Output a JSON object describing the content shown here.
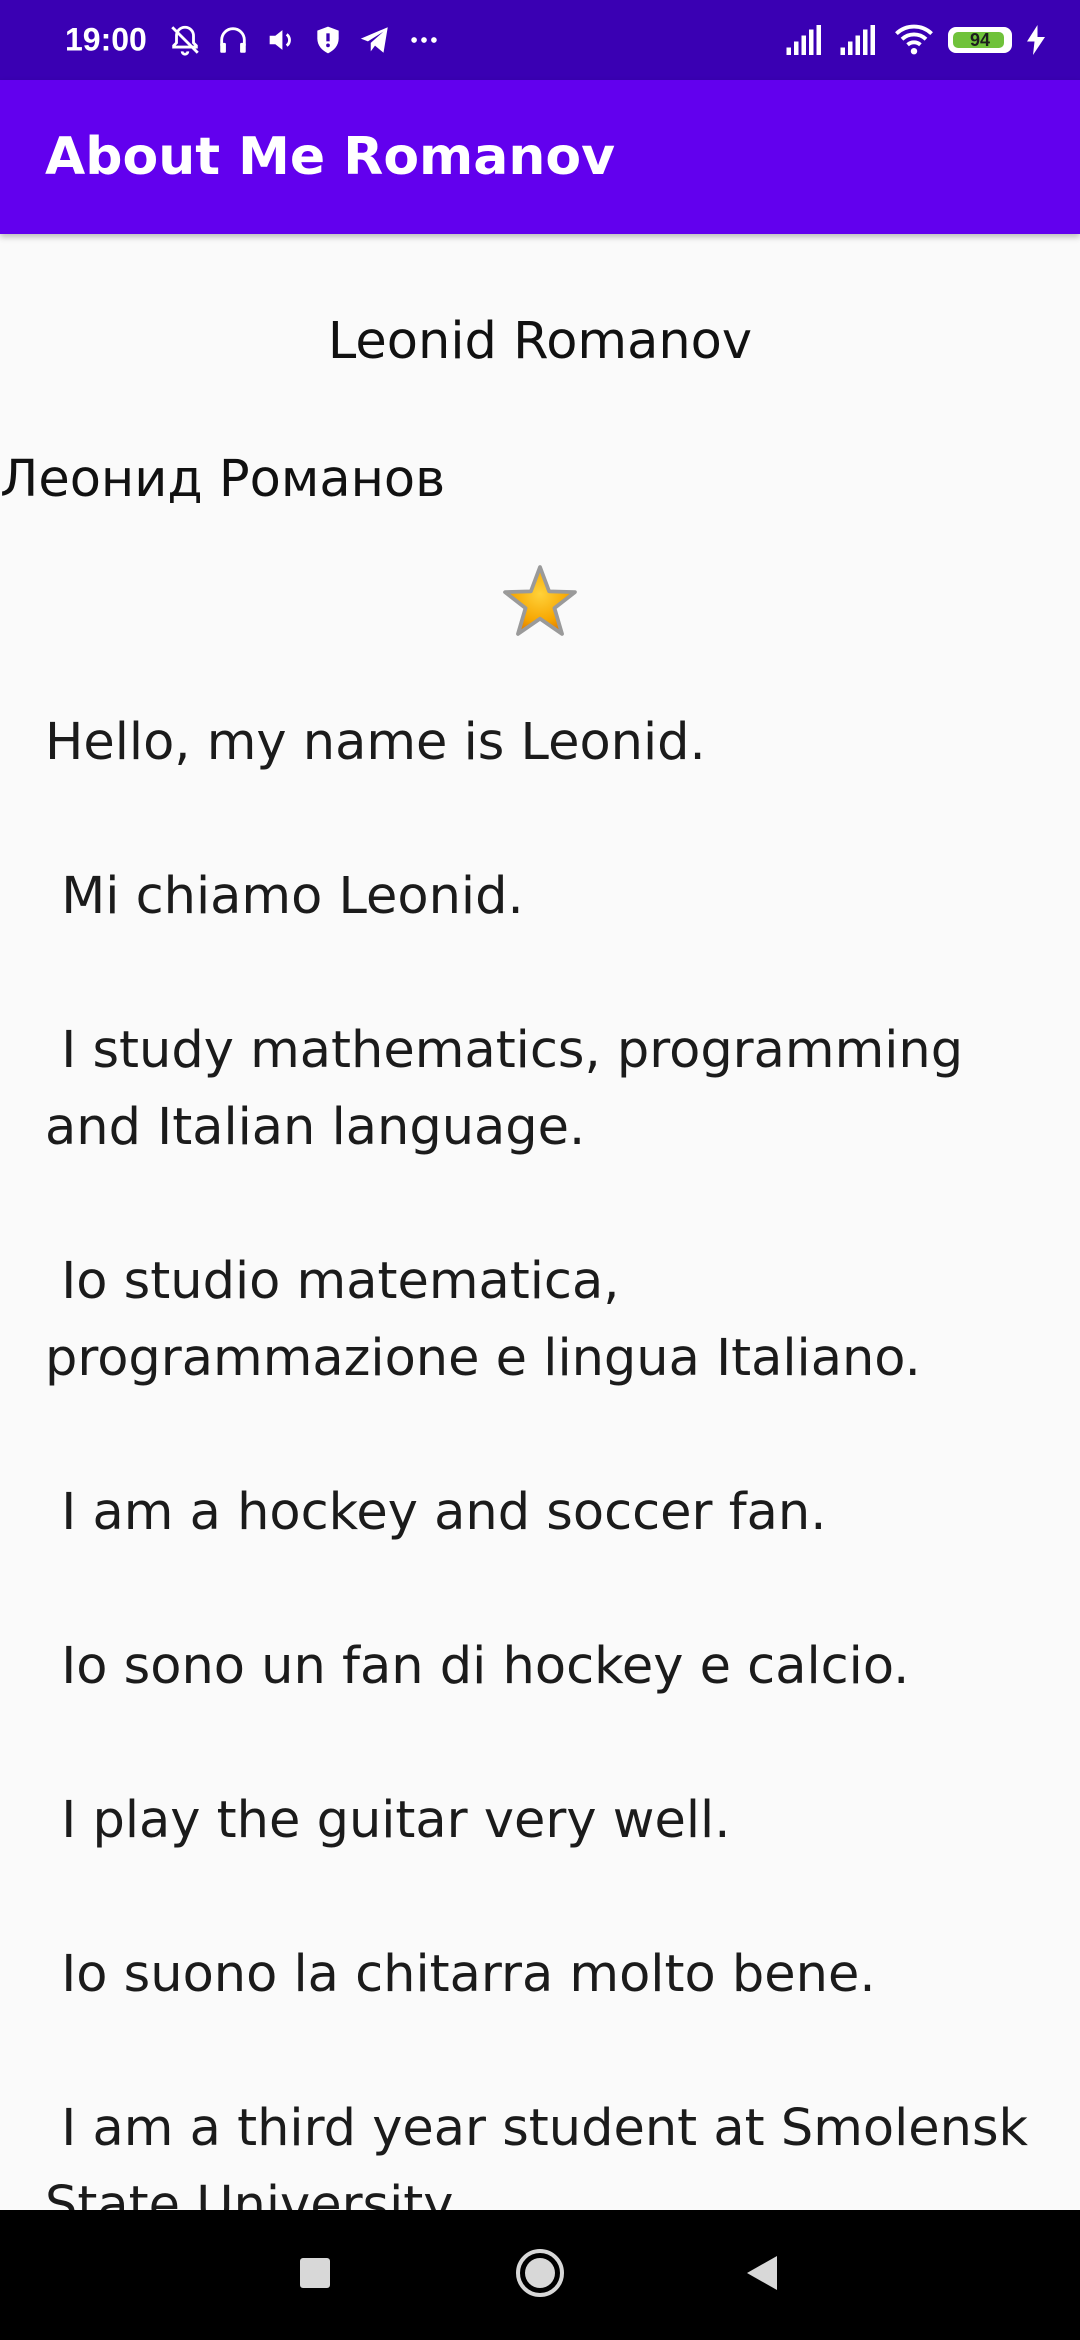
{
  "status_bar": {
    "time": "19:00",
    "battery_level": "94",
    "battery_fraction": 0.94,
    "left_icons": [
      "bell-off-icon",
      "headphones-icon",
      "volume-icon",
      "shield-icon",
      "telegram-icon",
      "more-icon"
    ],
    "right_icons": [
      "signal-icon",
      "signal-icon",
      "wifi-icon",
      "battery-icon",
      "charging-icon"
    ]
  },
  "app_bar": {
    "title": "About Me Romanov"
  },
  "profile": {
    "name": "Leonid Romanov",
    "nickname": "Леонид Романов",
    "star_icon": "star-icon"
  },
  "bio_text": "Hello, my name is Leonid.\n\n Mi chiamo Leonid.\n\n I study mathematics, programming and Italian language.\n\n Io studio matematica, programmazione e lingua Italiano.\n\n I am a hockey and soccer fan.\n\n Io sono un fan di hockey e calcio.\n\n I play the guitar very well.\n\n Io suono la chitarra molto bene.\n\n I am a third year student at Smolensk State University.",
  "nav_bar": {
    "recents": "square-icon",
    "home": "circle-icon",
    "back": "triangle-back-icon"
  },
  "colors": {
    "status_bar": "#3a00b3",
    "app_bar": "#6200ee",
    "background": "#fafafa",
    "star": "#f6a500"
  }
}
